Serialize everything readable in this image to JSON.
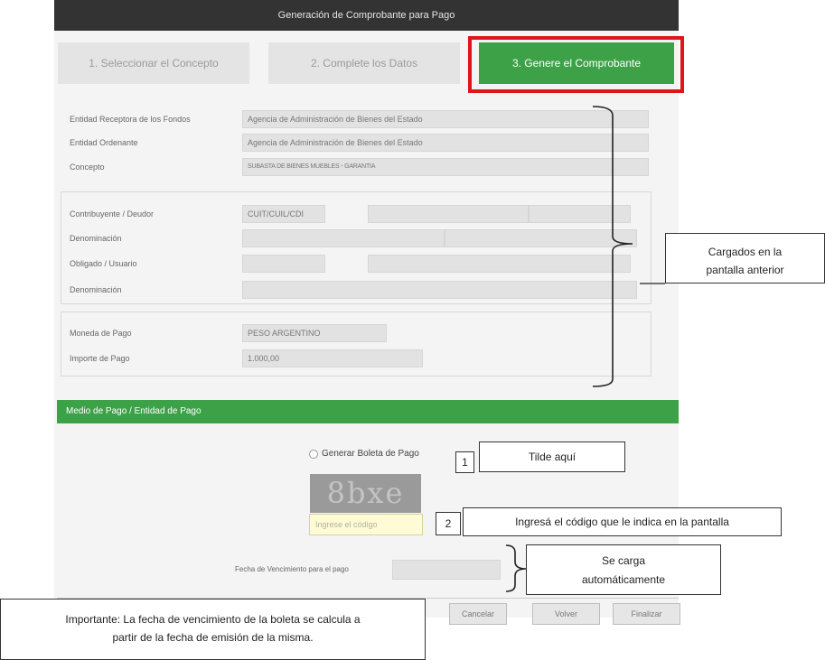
{
  "header": {
    "title": "Generación de Comprobante para Pago"
  },
  "steps": [
    {
      "label": "1. Seleccionar el Concepto"
    },
    {
      "label": "2. Complete los Datos"
    },
    {
      "label": "3. Genere el Comprobante"
    }
  ],
  "receptor": {
    "entidad_receptora_label": "Entidad Receptora de los Fondos",
    "entidad_receptora_value": "Agencia de Administración de Bienes del Estado",
    "entidad_ordenante_label": "Entidad Ordenante",
    "entidad_ordenante_value": "Agencia de Administración de Bienes del Estado",
    "concepto_label": "Concepto",
    "concepto_value": "SUBASTA DE BIENES MUEBLES - GARANTIA"
  },
  "contribuyente": {
    "contribuyente_label": "Contribuyente / Deudor",
    "tipo_id_value": "CUIT/CUIL/CDI",
    "denominacion_label": "Denominación",
    "obligado_label": "Obligado / Usuario",
    "denominacion2_label": "Denominación"
  },
  "pago": {
    "moneda_label": "Moneda de Pago",
    "moneda_value": "PESO ARGENTINO",
    "importe_label": "Importe de Pago",
    "importe_value": "1.000,00"
  },
  "medio_pago": {
    "section_title": "Medio de Pago / Entidad de Pago",
    "generar_boleta_label": "Generar Boleta de Pago",
    "captcha_text": "8bxe",
    "captcha_placeholder": "Ingrese el código",
    "fecha_label": "Fecha de Vencimiento para el pago"
  },
  "buttons": {
    "cancelar": "Cancelar",
    "volver": "Volver",
    "finalizar": "Finalizar"
  },
  "annotations": {
    "cargados_line1": "Cargados en la",
    "cargados_line2": "pantalla anterior",
    "num1": "1",
    "tilde": "Tilde aquí",
    "num2": "2",
    "ingresa": "Ingresá el código que le indica en la pantalla",
    "se_carga_line1": "Se carga",
    "se_carga_line2": "automáticamente",
    "importante_line1": "Importante: La fecha de vencimiento de la boleta se calcula a",
    "importante_line2": "partir de la fecha de emisión de la misma."
  },
  "colors": {
    "accent_green": "#3da148",
    "highlight_red": "#e0141c",
    "header_dark": "#333333"
  }
}
